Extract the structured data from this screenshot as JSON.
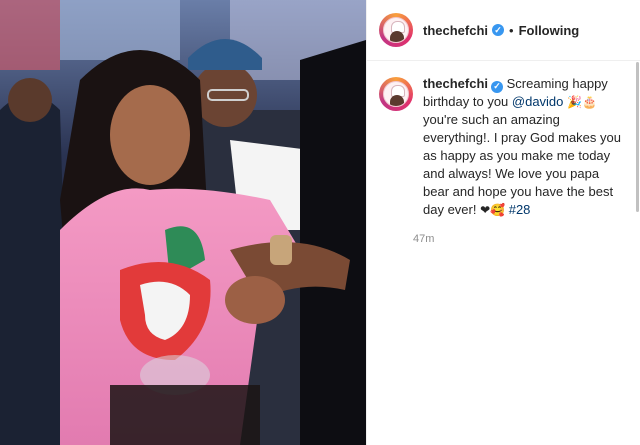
{
  "header": {
    "username": "thechefchi",
    "separator": "•",
    "follow_status": "Following",
    "more_label": "•••"
  },
  "caption": {
    "username": "thechefchi",
    "text_1": "Screaming happy birthday to you ",
    "mention": "@davido",
    "text_2": " you're such an amazing everything!. I pray God makes you as happy as you make me today and always! We love you papa bear and hope you have the best day ever! ",
    "emojis_1": "🎉🎂",
    "emojis_2": "❤🥰",
    "hashtag": "#28",
    "time": "47m"
  },
  "icons": {
    "verified": "verified-badge-icon",
    "more": "more-options-icon"
  },
  "colors": {
    "verified_blue": "#3897f0",
    "mention_blue": "#00376b",
    "meta_gray": "#8e8e8e"
  }
}
